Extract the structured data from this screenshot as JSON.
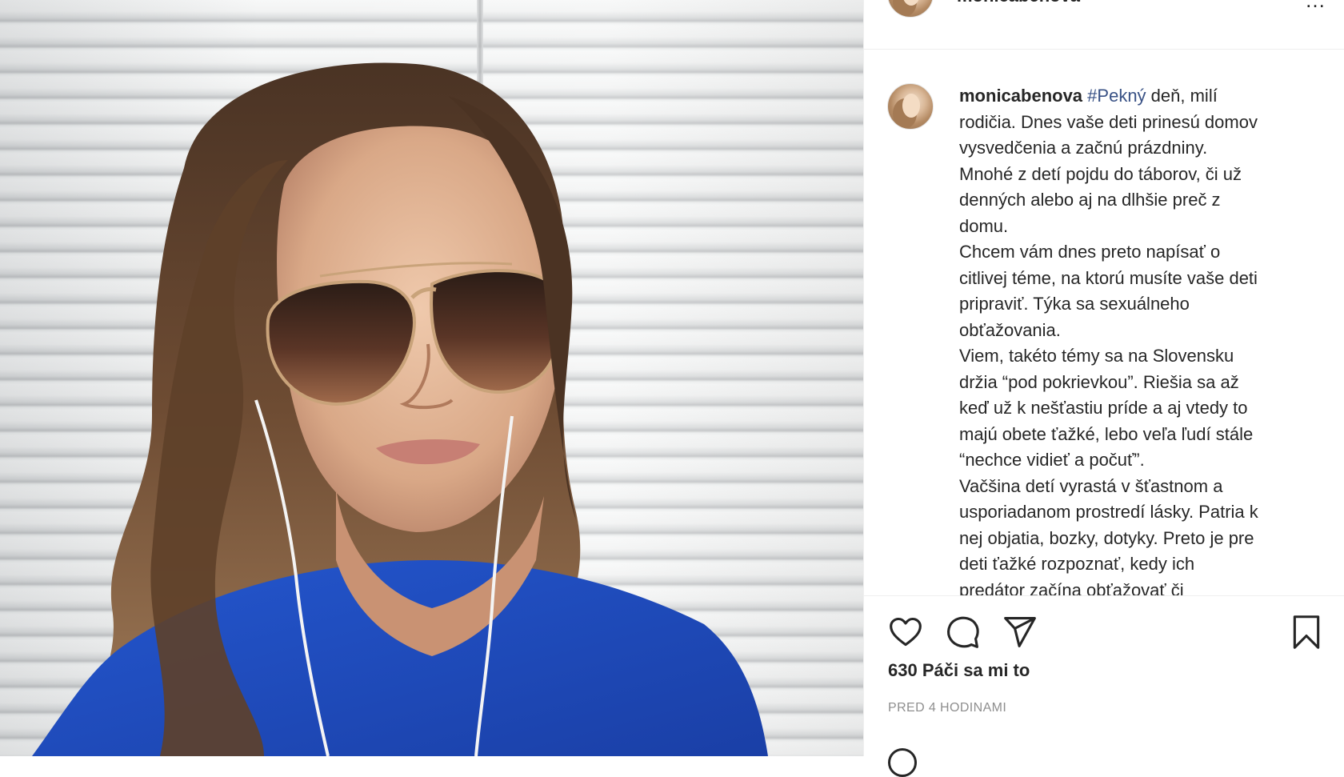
{
  "post": {
    "username": "monicabenova",
    "more_icon": "…",
    "caption": {
      "username": "monicabenova",
      "hashtag": "#Pekný",
      "text": " deň, milí\nrodičia. Dnes vaše deti prinesú domov\nvysvedčenia a začnú prázdniny.\nMnohé z detí pojdu do táborov, či už\ndenných alebo aj na dlhšie preč z\ndomu.\nChcem vám dnes preto napísať o\ncitlivej téme, na ktorú musíte vaše deti\npripraviť. Týka sa sexuálneho\nobťažovania.\nViem, takéto témy sa na Slovensku\ndržia “pod pokrievkou”. Riešia sa až\nkeď už k nešťastiu príde a aj vtedy to\nmajú obete ťažké, lebo veľa ľudí stále\n“nechce vidieť a počuť”.\nVačšina detí vyrastá v šťastnom a\nusporiadanom prostredí lásky. Patria k\nnej objatia, bozky, dotyky. Preto je pre\ndeti ťažké rozpoznať, kedy ich\npredátor začína obťažovať či"
    },
    "likes": "630 Páči sa mi to",
    "timestamp": "PRED 4 HODINAMI"
  },
  "icons": {
    "like": "heart-icon",
    "comment": "comment-icon",
    "share": "paper-plane-icon",
    "save": "bookmark-icon",
    "more": "more-options-icon"
  },
  "colors": {
    "hashtag": "#385185",
    "text": "#262626",
    "muted": "#8e8e8e",
    "border": "#efefef",
    "dress": "#1f4fc4"
  }
}
